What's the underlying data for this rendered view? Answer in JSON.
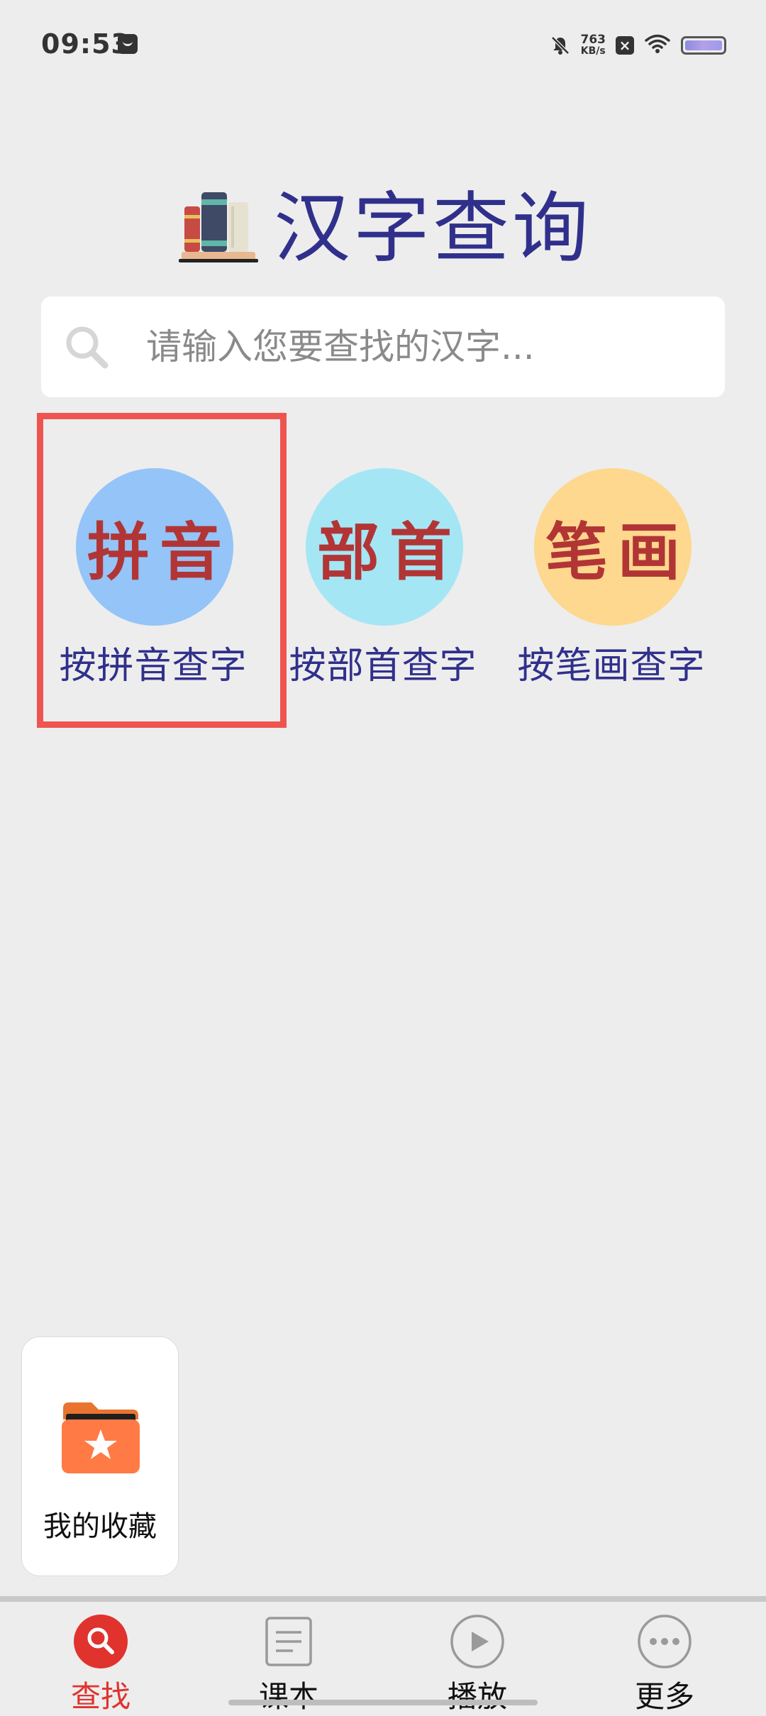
{
  "status_bar": {
    "time": "09:53",
    "net_speed_value": "763",
    "net_speed_unit": "KB/s"
  },
  "header": {
    "title": "汉字查询"
  },
  "search": {
    "placeholder": "请输入您要查找的汉字..."
  },
  "categories": [
    {
      "icon_text": "拼音",
      "label": "按拼音查字",
      "color": "#94c4f8"
    },
    {
      "icon_text": "部首",
      "label": "按部首查字",
      "color": "#a5e6f5"
    },
    {
      "icon_text": "笔画",
      "label": "按笔画查字",
      "color": "#fdd88e"
    }
  ],
  "favorites": {
    "label": "我的收藏"
  },
  "bottom_nav": {
    "items": [
      {
        "label": "查找",
        "icon": "search-icon",
        "active": true
      },
      {
        "label": "课本",
        "icon": "document-icon",
        "active": false
      },
      {
        "label": "播放",
        "icon": "play-icon",
        "active": false
      },
      {
        "label": "更多",
        "icon": "more-icon",
        "active": false
      }
    ]
  },
  "colors": {
    "accent": "#e0332e",
    "title": "#30308c",
    "highlight": "#ee5550"
  }
}
